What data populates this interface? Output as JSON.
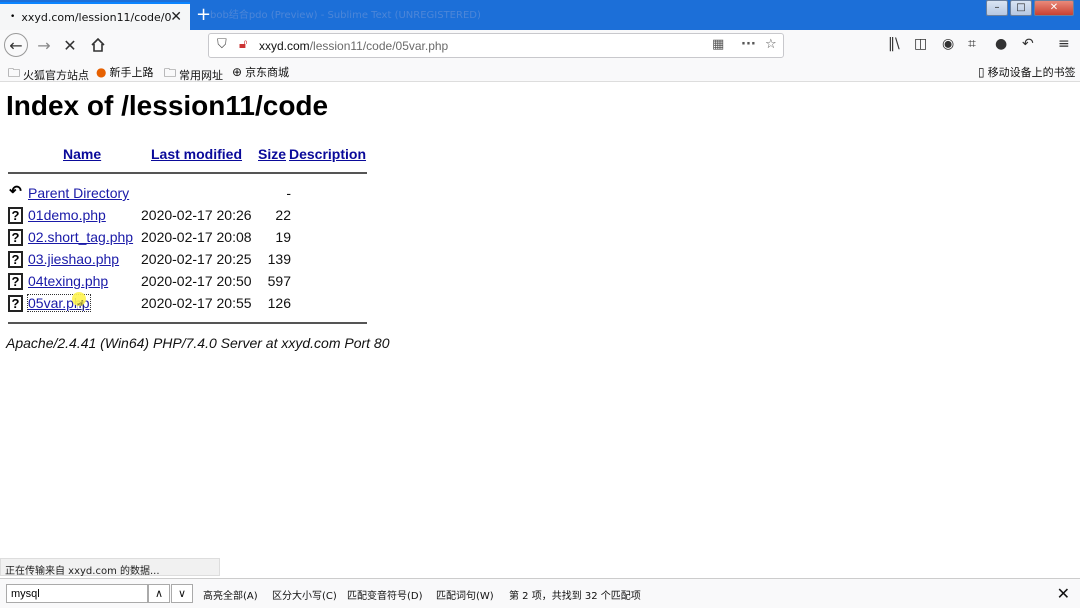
{
  "browser": {
    "tab_title": "xxyd.com/lession11/code/0!",
    "background_tab_title": "bob结合pdo (Preview) - Sublime Text (UNREGISTERED)",
    "url_domain": "xxyd.com",
    "url_path": "/lession11/code/05var.php",
    "new_tab_icon": "+",
    "close_tab_icon": "✕",
    "back_icon": "back-arrow",
    "forward_icon": "forward-arrow",
    "stop_icon": "✕",
    "home_icon": "home"
  },
  "bookmarks": [
    {
      "label": "火狐官方站点",
      "icon": "folder-icon"
    },
    {
      "label": "新手上路",
      "icon": "firefox-icon"
    },
    {
      "label": "常用网址",
      "icon": "folder-icon"
    },
    {
      "label": "京东商城",
      "icon": "globe-icon"
    }
  ],
  "mobile_bookmarks": "移动设备上的书签",
  "page": {
    "title": "Index of /lession11/code",
    "headers": {
      "name": "Name",
      "modified": "Last modified",
      "size": "Size",
      "description": "Description"
    },
    "rows": [
      {
        "name": "Parent Directory",
        "modified": "",
        "size": "-",
        "type": "dir"
      },
      {
        "name": "01demo.php",
        "modified": "2020-02-17 20:26",
        "size": "22",
        "type": "file"
      },
      {
        "name": "02.short_tag.php",
        "modified": "2020-02-17 20:08",
        "size": "19",
        "type": "file"
      },
      {
        "name": "03.jieshao.php",
        "modified": "2020-02-17 20:25",
        "size": "139",
        "type": "file"
      },
      {
        "name": "04texing.php",
        "modified": "2020-02-17 20:50",
        "size": "597",
        "type": "file"
      },
      {
        "name": "05var.php",
        "modified": "2020-02-17 20:55",
        "size": "126",
        "type": "file"
      }
    ],
    "address": "Apache/2.4.41 (Win64) PHP/7.4.0 Server at xxyd.com Port 80"
  },
  "status": "正在传输来自 xxyd.com 的数据...",
  "find": {
    "value": "mysql",
    "highlight_all": "高亮全部(A)",
    "match_case": "区分大小写(C)",
    "match_diacritics": "匹配变音符号(D)",
    "whole_words": "匹配词句(W)",
    "result": "第 2 项，共找到 32 个匹配项"
  },
  "colors": {
    "titlebar": "#1c6fd8",
    "link": "#1a1aa8",
    "accent": "#0a84ff"
  }
}
